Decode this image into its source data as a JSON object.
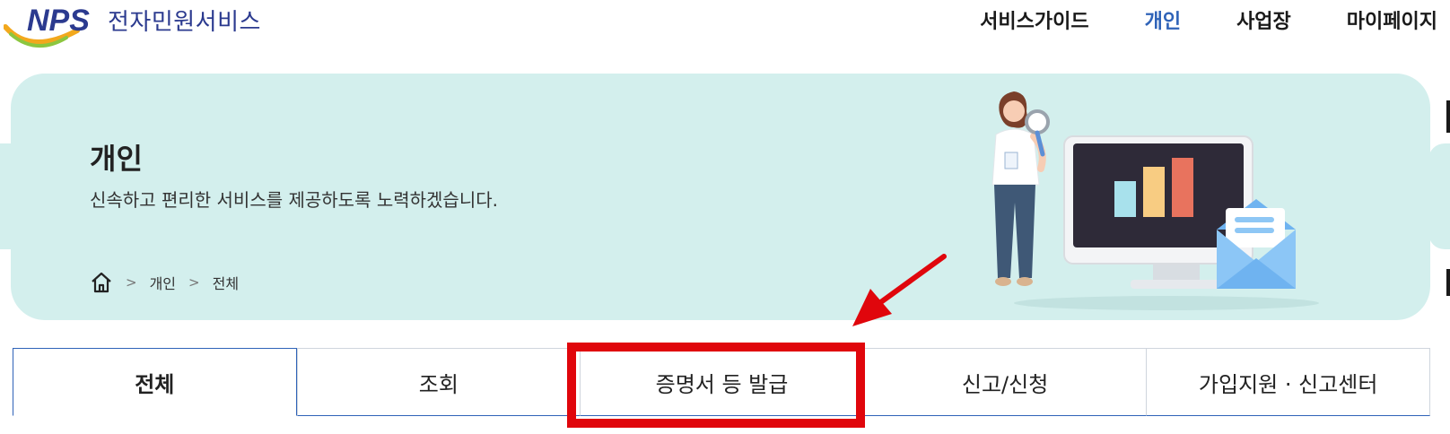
{
  "header": {
    "logo_text": "NPS",
    "service_name": "전자민원서비스",
    "nav": [
      {
        "label": "서비스가이드"
      },
      {
        "label": "개인"
      },
      {
        "label": "사업장"
      },
      {
        "label": "마이페이지"
      }
    ],
    "active_nav": "개인"
  },
  "banner": {
    "title": "개인",
    "description": "신속하고 편리한 서비스를 제공하도록 노력하겠습니다.",
    "breadcrumb": [
      "개인",
      "전체"
    ],
    "chart_bar_colors": [
      "#a8e1ec",
      "#f8cc82",
      "#e8735e"
    ]
  },
  "tabs": [
    {
      "label": "전체"
    },
    {
      "label": "조회"
    },
    {
      "label": "증명서 등 발급"
    },
    {
      "label": "신고/신청"
    },
    {
      "label": "가입지원 · 신고센터"
    }
  ],
  "active_tab": "전체",
  "highlighted_tab": "증명서 등 발급",
  "colors": {
    "brand_navy": "#2b3a8f",
    "nav_active": "#2f63b8",
    "banner_bg": "#d3efed",
    "highlight_red": "#e0060c"
  },
  "icons": {
    "home": "home-icon",
    "breadcrumb_separator": "chevron-right-icon",
    "annotation_arrow": "red-arrow-icon"
  }
}
